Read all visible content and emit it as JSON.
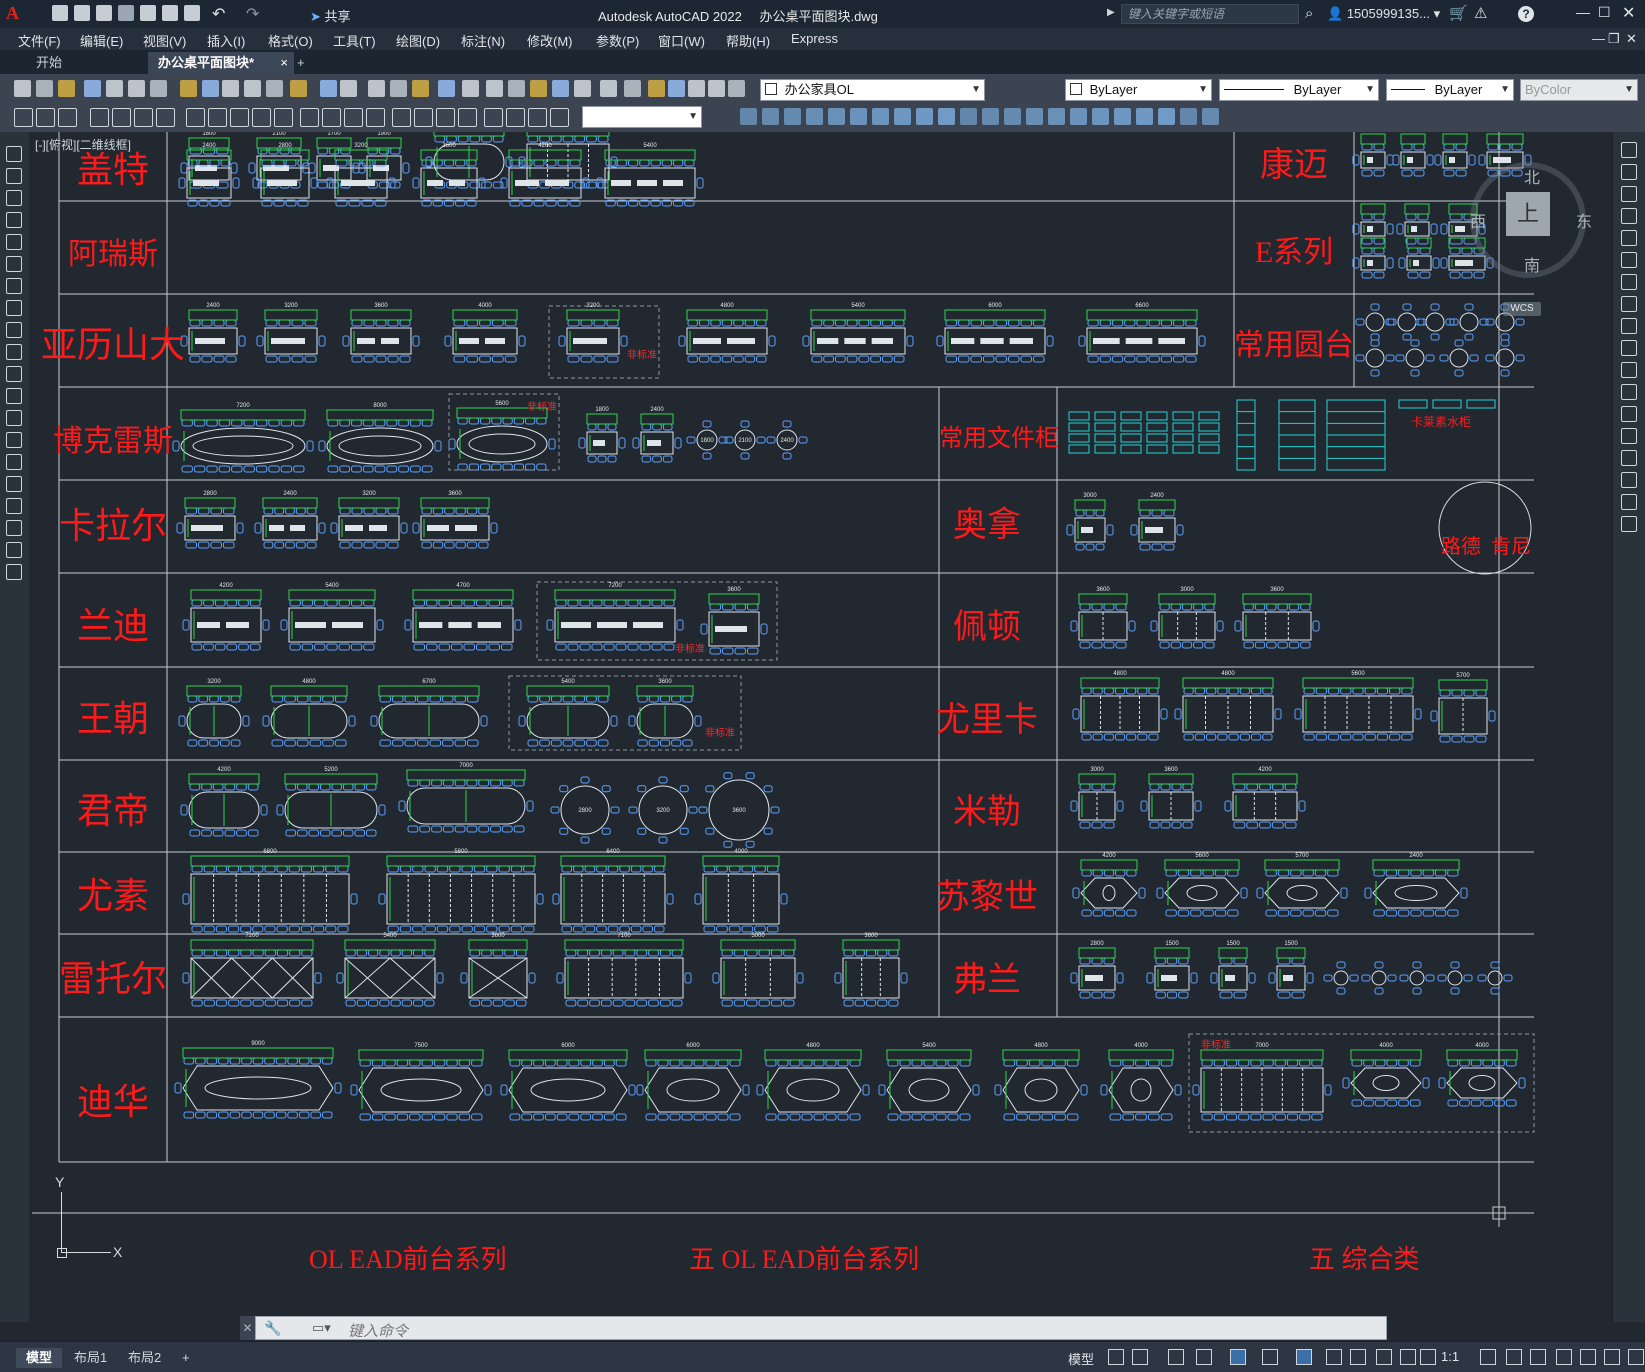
{
  "app": {
    "title": "Autodesk AutoCAD 2022",
    "filename": "办公桌平面图块.dwg",
    "share_label": "共享",
    "search_placeholder": "键入关键字或短语",
    "user": "1505999135...",
    "app_menu_letter": "A"
  },
  "menus": [
    "文件(F)",
    "编辑(E)",
    "视图(V)",
    "插入(I)",
    "格式(O)",
    "工具(T)",
    "绘图(D)",
    "标注(N)",
    "修改(M)",
    "参数(P)",
    "窗口(W)",
    "帮助(H)",
    "Express"
  ],
  "tabs": {
    "start": "开始",
    "active": "办公桌平面图块*",
    "add": "+",
    "close": "×"
  },
  "toolbar": {
    "layer_name": "办公家具OL",
    "color": "ByLayer",
    "linetype": "ByLayer",
    "lineweight": "ByLayer",
    "plotstyle": "ByColor",
    "text_style": ""
  },
  "viewport": {
    "label": "[-][俯视][二维线框]",
    "compass": {
      "n": "北",
      "s": "南",
      "e": "东",
      "w": "西",
      "top": "上",
      "wcs": "WCS"
    },
    "ucs": {
      "x": "X",
      "y": "Y"
    }
  },
  "drawing": {
    "series_left": [
      "盖特",
      "阿瑞斯",
      "亚历山大",
      "博克雷斯",
      "卡拉尔",
      "兰迪",
      "王朝",
      "君帝",
      "尤素",
      "雷托尔",
      "迪华"
    ],
    "series_mid": [
      "常用文件柜",
      "奥拿",
      "佩顿",
      "尤里卡",
      "米勒",
      "苏黎世",
      "弗兰"
    ],
    "series_right": [
      "康迈",
      "E系列",
      "常用圆台"
    ],
    "circle_labels": [
      "路德",
      "肯尼"
    ],
    "cabinet_label": "卡莱素水柜",
    "nonstandard": "非标准",
    "bottom_ghost": [
      "OL EAD前台系列",
      "五 OL EAD前台系列",
      "五 综合类"
    ],
    "dim_rows": [
      [
        "1800",
        "2100",
        "1700",
        "1900",
        "2400",
        "4800"
      ],
      [
        "2400",
        "2800",
        "3200",
        "3600",
        "4200",
        "5400"
      ],
      [
        "2400",
        "3200",
        "3600",
        "4000",
        "3200",
        "4800",
        "5400",
        "6000",
        "6600"
      ],
      [
        "7200",
        "8000",
        "5600",
        "1800",
        "2400",
        "1800",
        "2100",
        "2400"
      ],
      [
        "2800",
        "2400",
        "3200",
        "3600"
      ],
      [
        "4200",
        "5400",
        "4700",
        "7200",
        "3600"
      ],
      [
        "3200",
        "4800",
        "6700",
        "5400",
        "3600"
      ],
      [
        "4200",
        "5200",
        "7000",
        "2800",
        "3200",
        "3600"
      ],
      [
        "6800",
        "5800",
        "6400",
        "4000"
      ],
      [
        "7200",
        "5400",
        "3600",
        "7100",
        "5000",
        "3600"
      ],
      [
        "9000",
        "7500",
        "6000",
        "6000",
        "4800",
        "5400",
        "4800",
        "4000",
        "7000",
        "4000",
        "4000"
      ],
      [
        "3000",
        "2400",
        "3600",
        "3000",
        "3600",
        "4800",
        "4800",
        "5600",
        "5700",
        "3000",
        "3600",
        "4200",
        "4200",
        "5600",
        "5700",
        "2400",
        "2800",
        "1500",
        "1500"
      ]
    ]
  },
  "command": {
    "placeholder": "键入命令"
  },
  "status": {
    "layout_tabs": [
      "模型",
      "布局1",
      "布局2"
    ],
    "add": "+",
    "model_label": "模型",
    "scale": "1:1"
  }
}
